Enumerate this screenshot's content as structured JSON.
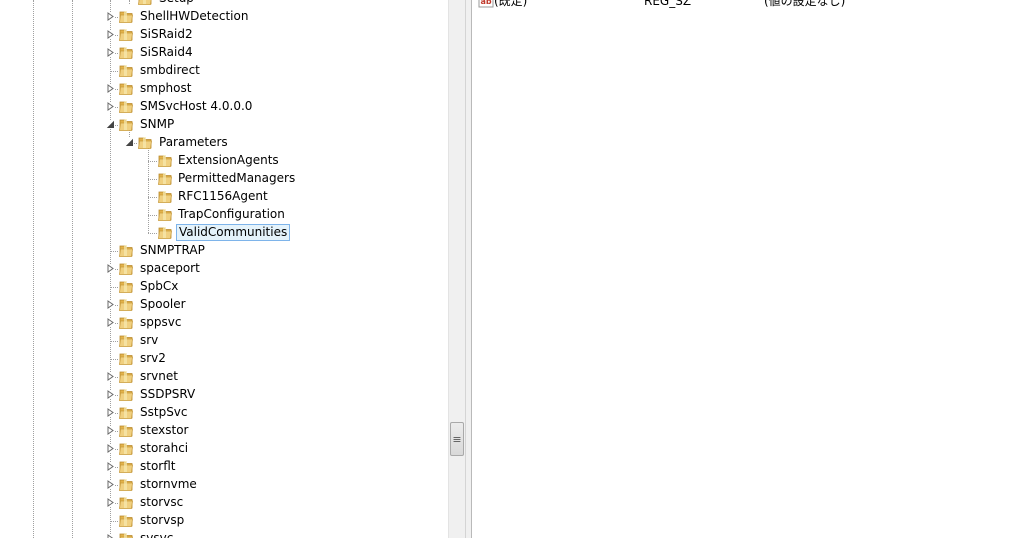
{
  "tree": {
    "nodes": [
      {
        "label": "Setup",
        "level": 2,
        "expander": "none"
      },
      {
        "label": "ShellHWDetection",
        "level": 1,
        "expander": "collapsed"
      },
      {
        "label": "SiSRaid2",
        "level": 1,
        "expander": "collapsed"
      },
      {
        "label": "SiSRaid4",
        "level": 1,
        "expander": "collapsed"
      },
      {
        "label": "smbdirect",
        "level": 1,
        "expander": "none"
      },
      {
        "label": "smphost",
        "level": 1,
        "expander": "collapsed"
      },
      {
        "label": "SMSvcHost 4.0.0.0",
        "level": 1,
        "expander": "collapsed"
      },
      {
        "label": "SNMP",
        "level": 1,
        "expander": "expanded"
      },
      {
        "label": "Parameters",
        "level": 2,
        "expander": "expanded"
      },
      {
        "label": "ExtensionAgents",
        "level": 3,
        "expander": "none"
      },
      {
        "label": "PermittedManagers",
        "level": 3,
        "expander": "none"
      },
      {
        "label": "RFC1156Agent",
        "level": 3,
        "expander": "none"
      },
      {
        "label": "TrapConfiguration",
        "level": 3,
        "expander": "none"
      },
      {
        "label": "ValidCommunities",
        "level": 3,
        "expander": "none",
        "selected": true
      },
      {
        "label": "SNMPTRAP",
        "level": 1,
        "expander": "none"
      },
      {
        "label": "spaceport",
        "level": 1,
        "expander": "collapsed"
      },
      {
        "label": "SpbCx",
        "level": 1,
        "expander": "none"
      },
      {
        "label": "Spooler",
        "level": 1,
        "expander": "collapsed"
      },
      {
        "label": "sppsvc",
        "level": 1,
        "expander": "collapsed"
      },
      {
        "label": "srv",
        "level": 1,
        "expander": "none"
      },
      {
        "label": "srv2",
        "level": 1,
        "expander": "none"
      },
      {
        "label": "srvnet",
        "level": 1,
        "expander": "collapsed"
      },
      {
        "label": "SSDPSRV",
        "level": 1,
        "expander": "collapsed"
      },
      {
        "label": "SstpSvc",
        "level": 1,
        "expander": "collapsed"
      },
      {
        "label": "stexstor",
        "level": 1,
        "expander": "collapsed"
      },
      {
        "label": "storahci",
        "level": 1,
        "expander": "collapsed"
      },
      {
        "label": "storflt",
        "level": 1,
        "expander": "collapsed"
      },
      {
        "label": "stornvme",
        "level": 1,
        "expander": "collapsed"
      },
      {
        "label": "storvsc",
        "level": 1,
        "expander": "collapsed"
      },
      {
        "label": "storvsp",
        "level": 1,
        "expander": "none"
      },
      {
        "label": "svsvc",
        "level": 1,
        "expander": "collapsed"
      }
    ]
  },
  "scrollbar": {
    "grip_glyph": "≡"
  },
  "values": {
    "rows": [
      {
        "name": "(既定)",
        "type": "REG_SZ",
        "data": "(値の設定なし)",
        "icon": "string-value-icon"
      }
    ]
  },
  "colors": {
    "folder": "#f0d080",
    "selection_bg": "#e5f3fb",
    "selection_border": "#7eb4ea"
  }
}
